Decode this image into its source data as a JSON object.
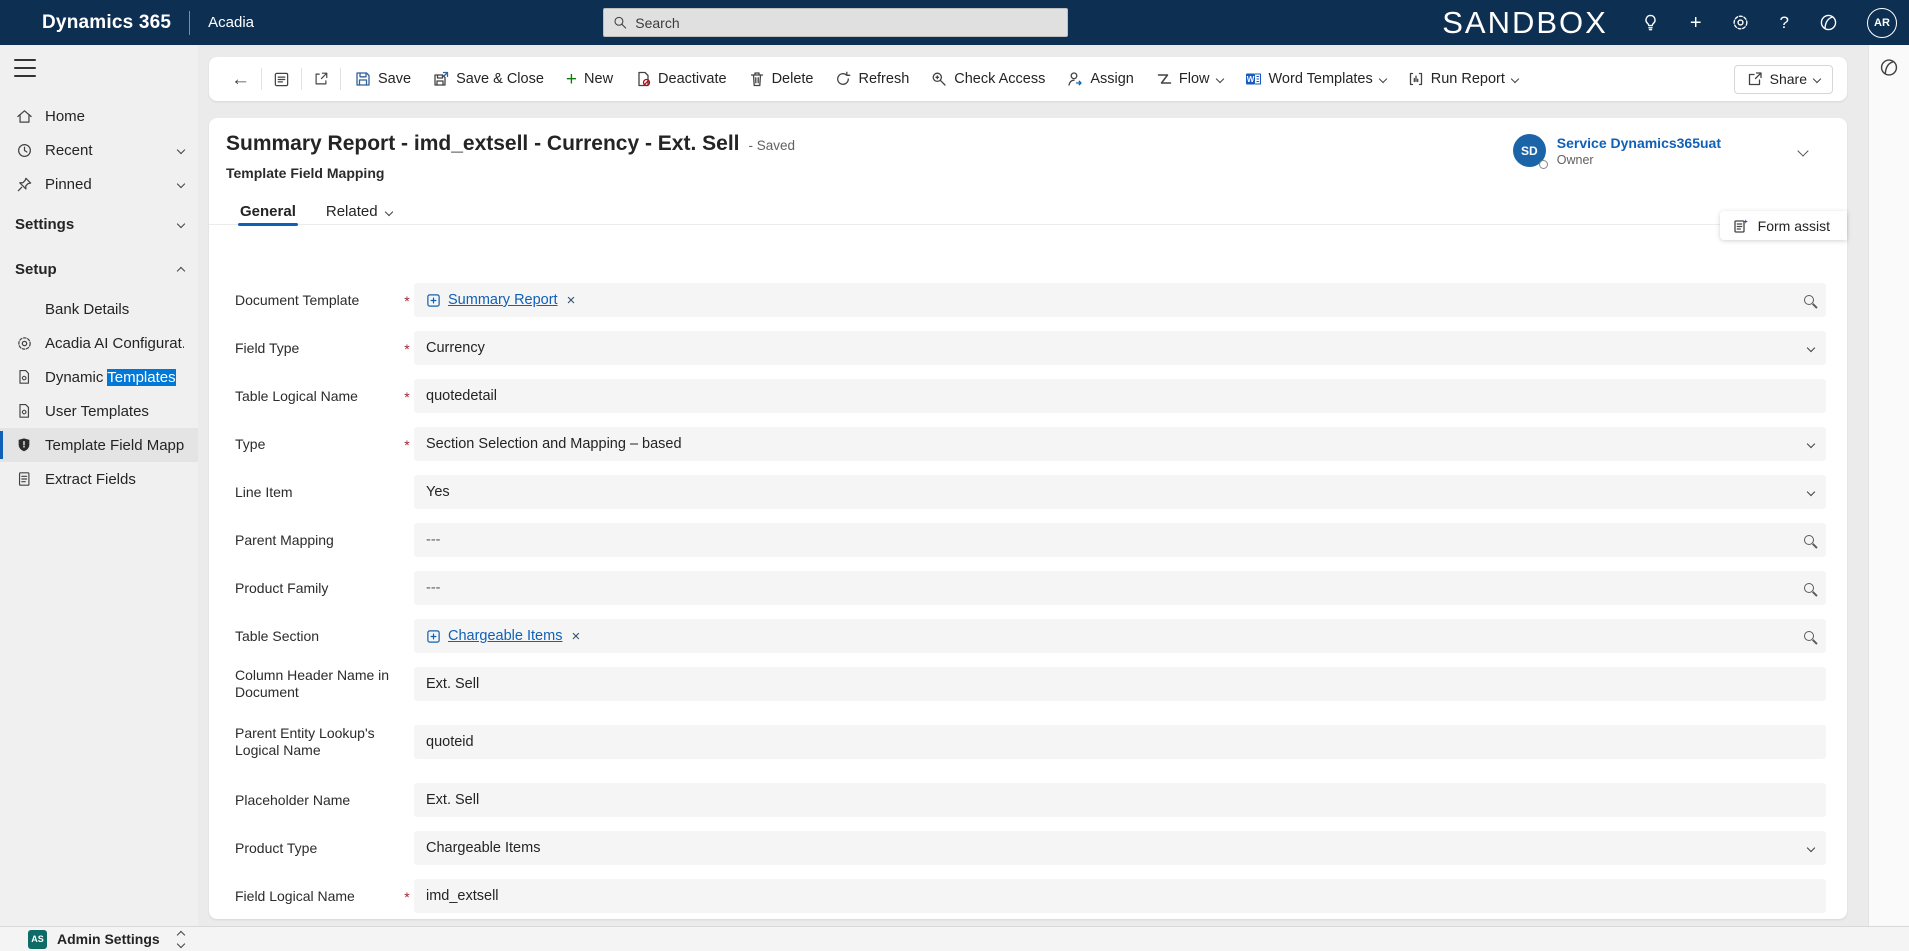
{
  "glyphs": {
    "plus": "+",
    "help": "?",
    "back": "←",
    "close": "×",
    "required": "*"
  },
  "colors": {
    "topbar": "#0d2f52",
    "accent": "#1160b7",
    "required": "#a4262c",
    "selection_highlight": "#0078d7",
    "new_button_green": "#107c10"
  },
  "icons": {
    "search-icon": "magnifier",
    "lightbulb-icon": "bulb",
    "gear-icon": "gear",
    "help-icon": "question-mark",
    "copilot-icon": "dynamics-copilot-rings",
    "hamburger-icon": "three-bars",
    "home-icon": "house",
    "recent-icon": "clock",
    "pinned-icon": "pushpin",
    "template-icon": "document-gear",
    "shield-icon": "filled-shield",
    "extract-icon": "document-lines",
    "back-icon": "left-arrow",
    "form-view-icon": "boxed-lines",
    "popout-icon": "box-arrow-out",
    "save-icon": "floppy-disk",
    "save-close-icon": "floppy-arrow",
    "new-icon": "green-plus",
    "deactivate-icon": "page-prohibit",
    "delete-icon": "trash-can",
    "refresh-icon": "circular-arrow",
    "check-access-icon": "key-magnifier",
    "assign-icon": "person-arrow",
    "flow-icon": "power-automate-z",
    "word-icon": "word-document",
    "report-icon": "bracket-bars",
    "share-icon": "page-share-arrow",
    "form-assist-icon": "form-sparkle",
    "updown-icon": "stacked-chevrons",
    "chevron-down-icon": "chevron-down",
    "chevron-up-icon": "chevron-up",
    "remove-icon": "x-cross"
  },
  "topbar": {
    "brand": "Dynamics 365",
    "app_name": "Acadia",
    "search_placeholder": "Search",
    "environment": "SANDBOX",
    "user_initials": "AR"
  },
  "toolbar": {
    "buttons": [
      {
        "label": "Save"
      },
      {
        "label": "Save & Close"
      },
      {
        "label": "New"
      },
      {
        "label": "Deactivate"
      },
      {
        "label": "Delete"
      },
      {
        "label": "Refresh"
      },
      {
        "label": "Check Access"
      },
      {
        "label": "Assign"
      },
      {
        "label": "Flow",
        "has_menu": true
      },
      {
        "label": "Word Templates",
        "has_menu": true
      },
      {
        "label": "Run Report",
        "has_menu": true
      }
    ],
    "share_label": "Share"
  },
  "sidebar": {
    "nav_items": [
      {
        "label": "Home"
      },
      {
        "label": "Recent",
        "expandable": true
      },
      {
        "label": "Pinned",
        "expandable": true
      }
    ],
    "group_settings": {
      "label": "Settings"
    },
    "group_setup": {
      "label": "Setup",
      "expanded": true
    },
    "setup_items": [
      {
        "label": "Bank Details"
      },
      {
        "label": "Acadia AI Configurat..."
      },
      {
        "label_prefix": "Dynamic ",
        "label_highlight": "Templates"
      },
      {
        "label": "User Templates"
      },
      {
        "label": "Template Field Mapp...",
        "active": true
      },
      {
        "label": "Extract Fields"
      }
    ],
    "footer": {
      "initials": "AS",
      "label": "Admin Settings"
    }
  },
  "record": {
    "title": "Summary Report - imd_extsell - Currency - Ext. Sell",
    "status": "- Saved",
    "entity_type": "Template Field Mapping",
    "tabs": {
      "general": "General",
      "related": "Related"
    },
    "owner": {
      "initials": "SD",
      "name": "Service Dynamics365uat",
      "role": "Owner"
    },
    "form_assist_label": "Form assist"
  },
  "form": {
    "fields": [
      {
        "label": "Document Template",
        "required": true,
        "type": "lookup",
        "value": "Summary Report"
      },
      {
        "label": "Field Type",
        "required": true,
        "type": "select",
        "value": "Currency"
      },
      {
        "label": "Table Logical Name",
        "required": true,
        "type": "text",
        "value": "quotedetail"
      },
      {
        "label": "Type",
        "required": true,
        "type": "select",
        "value": "Section Selection and Mapping – based"
      },
      {
        "label": "Line Item",
        "required": false,
        "type": "select",
        "value": "Yes"
      },
      {
        "label": "Parent Mapping",
        "required": false,
        "type": "lookup-empty",
        "value": "---"
      },
      {
        "label": "Product Family",
        "required": false,
        "type": "lookup-empty",
        "value": "---"
      },
      {
        "label": "Table Section",
        "required": false,
        "type": "lookup",
        "value": "Chargeable Items"
      },
      {
        "label": "Column Header Name in Document",
        "required": false,
        "type": "text",
        "value": "Ext. Sell"
      },
      {
        "label": "Parent Entity Lookup's Logical Name",
        "required": false,
        "type": "text",
        "value": "quoteid"
      },
      {
        "label": "Placeholder Name",
        "required": false,
        "type": "text",
        "value": "Ext. Sell"
      },
      {
        "label": "Product Type",
        "required": false,
        "type": "select",
        "value": "Chargeable Items"
      },
      {
        "label": "Field Logical Name",
        "required": true,
        "type": "text",
        "value": "imd_extsell"
      }
    ]
  }
}
